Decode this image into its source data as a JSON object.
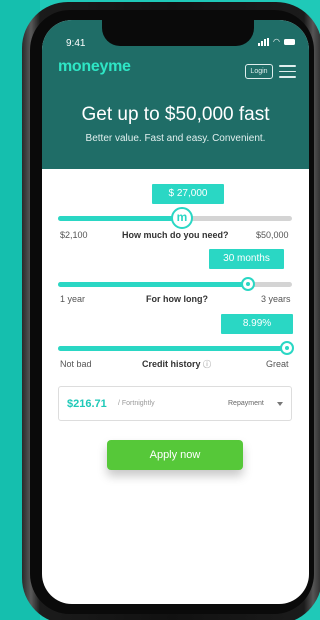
{
  "status": {
    "time": "9:41"
  },
  "header": {
    "logo": "moneyme",
    "login_label": "Login",
    "headline": "Get up to $50,000 fast",
    "subheadline": "Better value. Fast and easy. Convenient."
  },
  "amount_slider": {
    "value_label": "$ 27,000",
    "min_label": "$2,100",
    "label": "How much do you need?",
    "max_label": "$50,000",
    "fraction": 0.53,
    "thumb_glyph": "m"
  },
  "term_slider": {
    "value_label": "30 months",
    "min_label": "1 year",
    "label": "For how long?",
    "max_label": "3 years",
    "fraction": 0.81
  },
  "credit_slider": {
    "value_label": "8.99%",
    "min_label": "Not bad",
    "label": "Credit history",
    "max_label": "Great",
    "fraction": 0.98,
    "info_icon": "info-icon"
  },
  "repayment": {
    "amount": "$216.71",
    "period": "/ Fortnightly",
    "select_label": "Repayment"
  },
  "apply_label": "Apply now",
  "colors": {
    "background": "#1fc9b8",
    "header": "#1f6d67",
    "logo": "#2ee6c5",
    "accent": "#2ad7c4",
    "button": "#56c839"
  }
}
